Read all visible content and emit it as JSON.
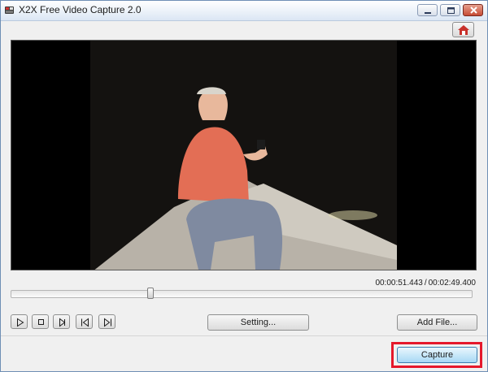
{
  "window": {
    "title": "X2X Free Video Capture 2.0",
    "icon": "app-film-icon",
    "controls": [
      "minimize-icon",
      "maximize-icon",
      "close-icon"
    ]
  },
  "toolbar": {
    "home_icon": "home-icon"
  },
  "video": {
    "frame_description_icon": "video-frame"
  },
  "playback": {
    "current_time": "00:00:51.443",
    "separator": "/",
    "total_time": "00:02:49.400",
    "progress_fraction": 0.3035
  },
  "controls": {
    "buttons": [
      {
        "name": "play-button",
        "icon": "play-icon"
      },
      {
        "name": "stop-button",
        "icon": "stop-icon"
      },
      {
        "name": "step-forward-button",
        "icon": "step-forward-icon"
      },
      {
        "name": "previous-button",
        "icon": "skip-back-icon"
      },
      {
        "name": "next-button",
        "icon": "skip-forward-icon"
      }
    ],
    "setting_label": "Setting...",
    "add_file_label": "Add File...",
    "capture_label": "Capture"
  },
  "colors": {
    "highlight": "#e5182b",
    "capture_button": "#a7d9f5"
  }
}
